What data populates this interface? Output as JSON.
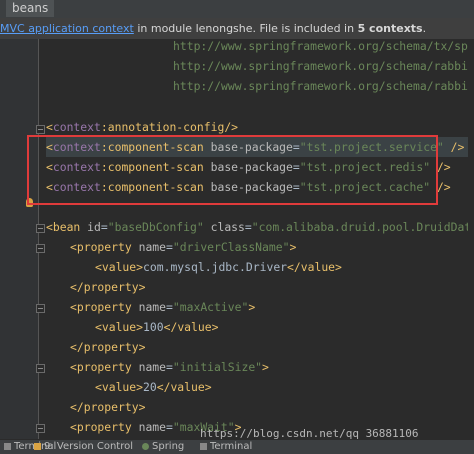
{
  "tab": {
    "label": "beans"
  },
  "notice": {
    "link": "MVC application context",
    "text1": " in module ",
    "module": "lenongshe",
    "text2": ". File is included in ",
    "count": "5 contexts",
    "text3": "."
  },
  "code": {
    "url_tx": "http://www.springframework.org/schema/tx/spring",
    "url_rabbit": "http://www.springframework.org/schema/rabbit",
    "url_rabbit_xsd": "http://www.springframework.org/schema/rabbit/sp",
    "annotation_config": "annotation-config",
    "component_scan": "component-scan",
    "context_ns": "context",
    "base_package_attr": "base-package",
    "pkg_service": "\"tst.project.service\"",
    "pkg_redis": "\"tst.project.redis\"",
    "pkg_cache": "\"tst.project.cache\"",
    "bean_tag": "bean",
    "id_attr": "id",
    "bean_id": "\"baseDbConfig\"",
    "class_attr": "class",
    "bean_class": "\"com.alibaba.druid.pool.DruidDataSour",
    "property_tag": "property",
    "name_attr": "name",
    "prop1_name": "\"driverClassName\"",
    "prop1_value": "com.mysql.jdbc.Driver",
    "prop2_name": "\"maxActive\"",
    "prop2_value": "100",
    "prop3_name": "\"initialSize\"",
    "prop3_value": "20",
    "prop4_name": "\"maxWait\"",
    "value_tag": "value"
  },
  "status": {
    "item1": "Terminal",
    "item2": "9: Version Control",
    "item3": "Spring",
    "item4": "Terminal"
  },
  "watermark": "https://blog.csdn.net/qq_36881106"
}
